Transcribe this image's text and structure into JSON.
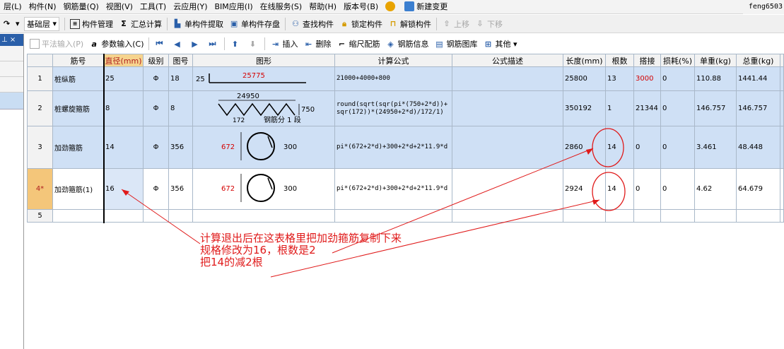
{
  "menubar": {
    "items": [
      "层(L)",
      "构件(N)",
      "钢筋量(Q)",
      "视图(V)",
      "工具(T)",
      "云应用(Y)",
      "BIM应用(I)",
      "在线服务(S)",
      "帮助(H)",
      "版本号(B)"
    ],
    "new_change": "新建变更",
    "user": "feng6503"
  },
  "toolbar1": {
    "layer": "基础层",
    "items": [
      "构件管理",
      "汇总计算",
      "单构件提取",
      "单构件存盘",
      "查找构件",
      "锁定构件",
      "解锁构件",
      "上移",
      "下移"
    ]
  },
  "toolbar2": {
    "items": [
      "平法输入(P)",
      "参数输入(C)",
      "插入",
      "删除",
      "缩尺配筋",
      "钢筋信息",
      "钢筋图库",
      "其他"
    ]
  },
  "grid": {
    "headers": [
      "筋号",
      "直径(mm)",
      "级别",
      "图号",
      "图形",
      "计算公式",
      "公式描述",
      "长度(mm)",
      "根数",
      "搭接",
      "损耗(%)",
      "单重(kg)",
      "总重(kg)"
    ],
    "rows": [
      {
        "num": "1",
        "name": "桩纵筋",
        "dia": "25",
        "grade": "Φ",
        "fig": "18",
        "shape_a": "25",
        "shape_b": "25775",
        "formula": "21000+4000+800",
        "desc": "",
        "length": "25800",
        "count": "13",
        "lap": "3000",
        "loss": "0",
        "unit": "110.88",
        "total": "1441.44"
      },
      {
        "num": "2",
        "name": "桩螺旋箍筋",
        "dia": "8",
        "grade": "Φ",
        "fig": "8",
        "shape_a": "24950",
        "shape_b": "750",
        "shape_c": "172",
        "shape_d": "钢筋分 1 段",
        "formula": "round(sqrt(sqr(pi*(750+2*d))+sqr(172))*(24950+2*d)/172/1)",
        "desc": "",
        "length": "350192",
        "count": "1",
        "lap": "21344",
        "loss": "0",
        "unit": "146.757",
        "total": "146.757"
      },
      {
        "num": "3",
        "name": "加劲箍筋",
        "dia": "14",
        "grade": "Φ",
        "fig": "356",
        "shape_a": "672",
        "shape_b": "300",
        "formula": "pi*(672+2*d)+300+2*d+2*11.9*d",
        "desc": "",
        "length": "2860",
        "count": "14",
        "lap": "0",
        "loss": "0",
        "unit": "3.461",
        "total": "48.448"
      },
      {
        "num": "4*",
        "name": "加劲箍筋(1)",
        "dia": "16",
        "grade": "Φ",
        "fig": "356",
        "shape_a": "672",
        "shape_b": "300",
        "formula": "pi*(672+2*d)+300+2*d+2*11.9*d",
        "desc": "",
        "length": "2924",
        "count": "14",
        "lap": "0",
        "loss": "0",
        "unit": "4.62",
        "total": "64.679"
      },
      {
        "num": "5"
      }
    ]
  },
  "annotation": {
    "line1": "计算退出后在这表格里把加劲箍筋复制下来",
    "line2": "规格修改为16，根数是2",
    "line3": "把14的减2根"
  },
  "colors": {
    "accent_red": "#e01a1a",
    "selection": "#cfe0f5",
    "header_highlight": "#f6d48e"
  }
}
